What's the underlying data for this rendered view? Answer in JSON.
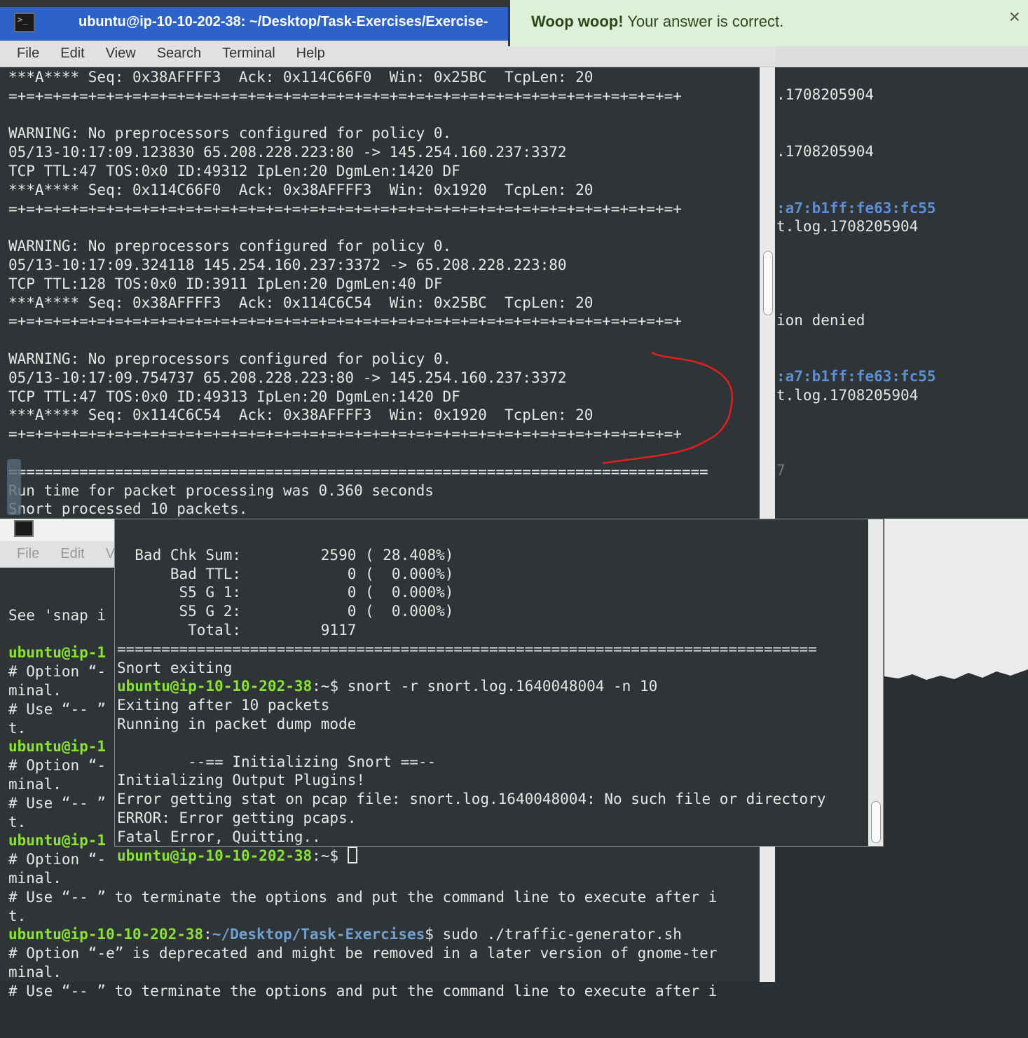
{
  "top_window": {
    "title": "ubuntu@ip-10-10-202-38: ~/Desktop/Task-Exercises/Exercise-",
    "menu": [
      "File",
      "Edit",
      "View",
      "Search",
      "Terminal",
      "Help"
    ],
    "lines": [
      "***A**** Seq: 0x38AFFFF3  Ack: 0x114C66F0  Win: 0x25BC  TcpLen: 20",
      "=+=+=+=+=+=+=+=+=+=+=+=+=+=+=+=+=+=+=+=+=+=+=+=+=+=+=+=+=+=+=+=+=+=+=+=+=+=+",
      "",
      "WARNING: No preprocessors configured for policy 0.",
      "05/13-10:17:09.123830 65.208.228.223:80 -> 145.254.160.237:3372",
      "TCP TTL:47 TOS:0x0 ID:49312 IpLen:20 DgmLen:1420 DF",
      "***A**** Seq: 0x114C66F0  Ack: 0x38AFFFF3  Win: 0x1920  TcpLen: 20",
      "=+=+=+=+=+=+=+=+=+=+=+=+=+=+=+=+=+=+=+=+=+=+=+=+=+=+=+=+=+=+=+=+=+=+=+=+=+=+",
      "",
      "WARNING: No preprocessors configured for policy 0.",
      "05/13-10:17:09.324118 145.254.160.237:3372 -> 65.208.228.223:80",
      "TCP TTL:128 TOS:0x0 ID:3911 IpLen:20 DgmLen:40 DF",
      "***A**** Seq: 0x38AFFFF3  Ack: 0x114C6C54  Win: 0x25BC  TcpLen: 20",
      "=+=+=+=+=+=+=+=+=+=+=+=+=+=+=+=+=+=+=+=+=+=+=+=+=+=+=+=+=+=+=+=+=+=+=+=+=+=+",
      "",
      "WARNING: No preprocessors configured for policy 0.",
      "05/13-10:17:09.754737 65.208.228.223:80 -> 145.254.160.237:3372",
      "TCP TTL:47 TOS:0x0 ID:49313 IpLen:20 DgmLen:1420 DF",
      "***A**** Seq: 0x114C6C54  Ack: 0x38AFFFF3  Win: 0x1920  TcpLen: 20",
      "=+=+=+=+=+=+=+=+=+=+=+=+=+=+=+=+=+=+=+=+=+=+=+=+=+=+=+=+=+=+=+=+=+=+=+=+=+=+",
      "",
      "===============================================================================",
      "Run time for packet processing was 0.360 seconds",
      "Snort processed 10 packets."
    ]
  },
  "notification": {
    "bold": "Woop woop!",
    "text": " Your answer is correct.",
    "close": "×"
  },
  "right_bg": {
    "l1": ".1708205904",
    "l2": ".1708205904",
    "l3": ":a7:b1ff:fe63:fc55",
    "l4": "t.log.1708205904",
    "l5": "ion denied",
    "l6": ":a7:b1ff:fe63:fc55",
    "l7": "t.log.1708205904",
    "l8": "7"
  },
  "bottom_left": {
    "menu": [
      "File",
      "Edit",
      "V"
    ],
    "see": "See 'snap i",
    "prompt_frag": "ubuntu@ip-1",
    "opt_frag": "# Option “-",
    "minal": "minal.",
    "use_frag": "# Use “-- ”",
    "t": "t.",
    "use_full": "# Use “-- ” to terminate the options and put the command line to execute after i",
    "prompt_user": "ubuntu@ip-10-10-202-38",
    "prompt_colon": ":",
    "prompt_path": "~/Desktop/Task-Exercises",
    "prompt_dollar": "$ sudo ./traffic-generator.sh",
    "opt_full": "# Option “-e” is deprecated and might be removed in a later version of gnome-ter"
  },
  "middle_window": {
    "stats": [
      "  Bad Chk Sum:         2590 ( 28.408%)",
      "      Bad TTL:            0 (  0.000%)",
      "       S5 G 1:            0 (  0.000%)",
      "       S5 G 2:            0 (  0.000%)",
      "        Total:         9117"
    ],
    "separator": "===============================================================================",
    "exiting": "Snort exiting",
    "prompt_user": "ubuntu@ip-10-10-202-38",
    "prompt_rest": ":~$ snort -r snort.log.1640048004 -n 10",
    "out": [
      "Exiting after 10 packets",
      "Running in packet dump mode",
      "",
      "        --== Initializing Snort ==--",
      "Initializing Output Plugins!",
      "Error getting stat on pcap file: snort.log.1640048004: No such file or directory",
      "ERROR: Error getting pcaps.",
      "Fatal Error, Quitting.."
    ],
    "prompt2_user": "ubuntu@ip-10-10-202-38",
    "prompt2_rest": ":~$ "
  },
  "colors": {
    "prompt_green": "#8ae234",
    "path_blue": "#729fcf",
    "terminal_bg": "#2f3436",
    "notification_bg": "#dff0d8",
    "annotation_red": "#e02020"
  }
}
